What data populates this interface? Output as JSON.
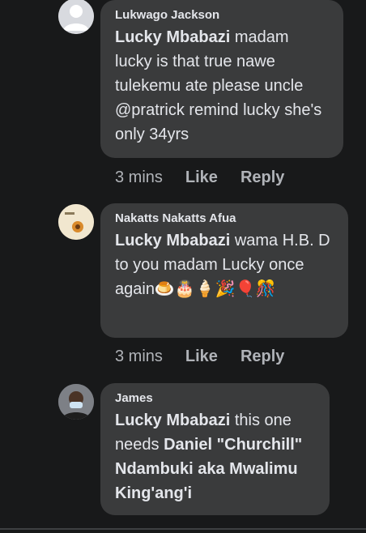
{
  "comments": [
    {
      "author": "Lukwago Jackson",
      "mention": "Lucky Mbabazi",
      "body": " madam lucky is that true nawe tulekemu ate please uncle @pratrick remind lucky she's only 34yrs",
      "time": "3 mins",
      "like": "Like",
      "reply": "Reply"
    },
    {
      "author": "Nakatts Nakatts Afua",
      "mention": "Lucky Mbabazi",
      "body": " wama H.B. D to you madam Lucky once again🍮🎂🍦🎉🎈🎊",
      "time": "3 mins",
      "like": "Like",
      "reply": "Reply"
    },
    {
      "author": "James",
      "mention": "Lucky Mbabazi",
      "body_a": " this one needs ",
      "mention2": "Daniel \"Churchill\" Ndambuki aka Mwalimu King'ang'i"
    }
  ]
}
